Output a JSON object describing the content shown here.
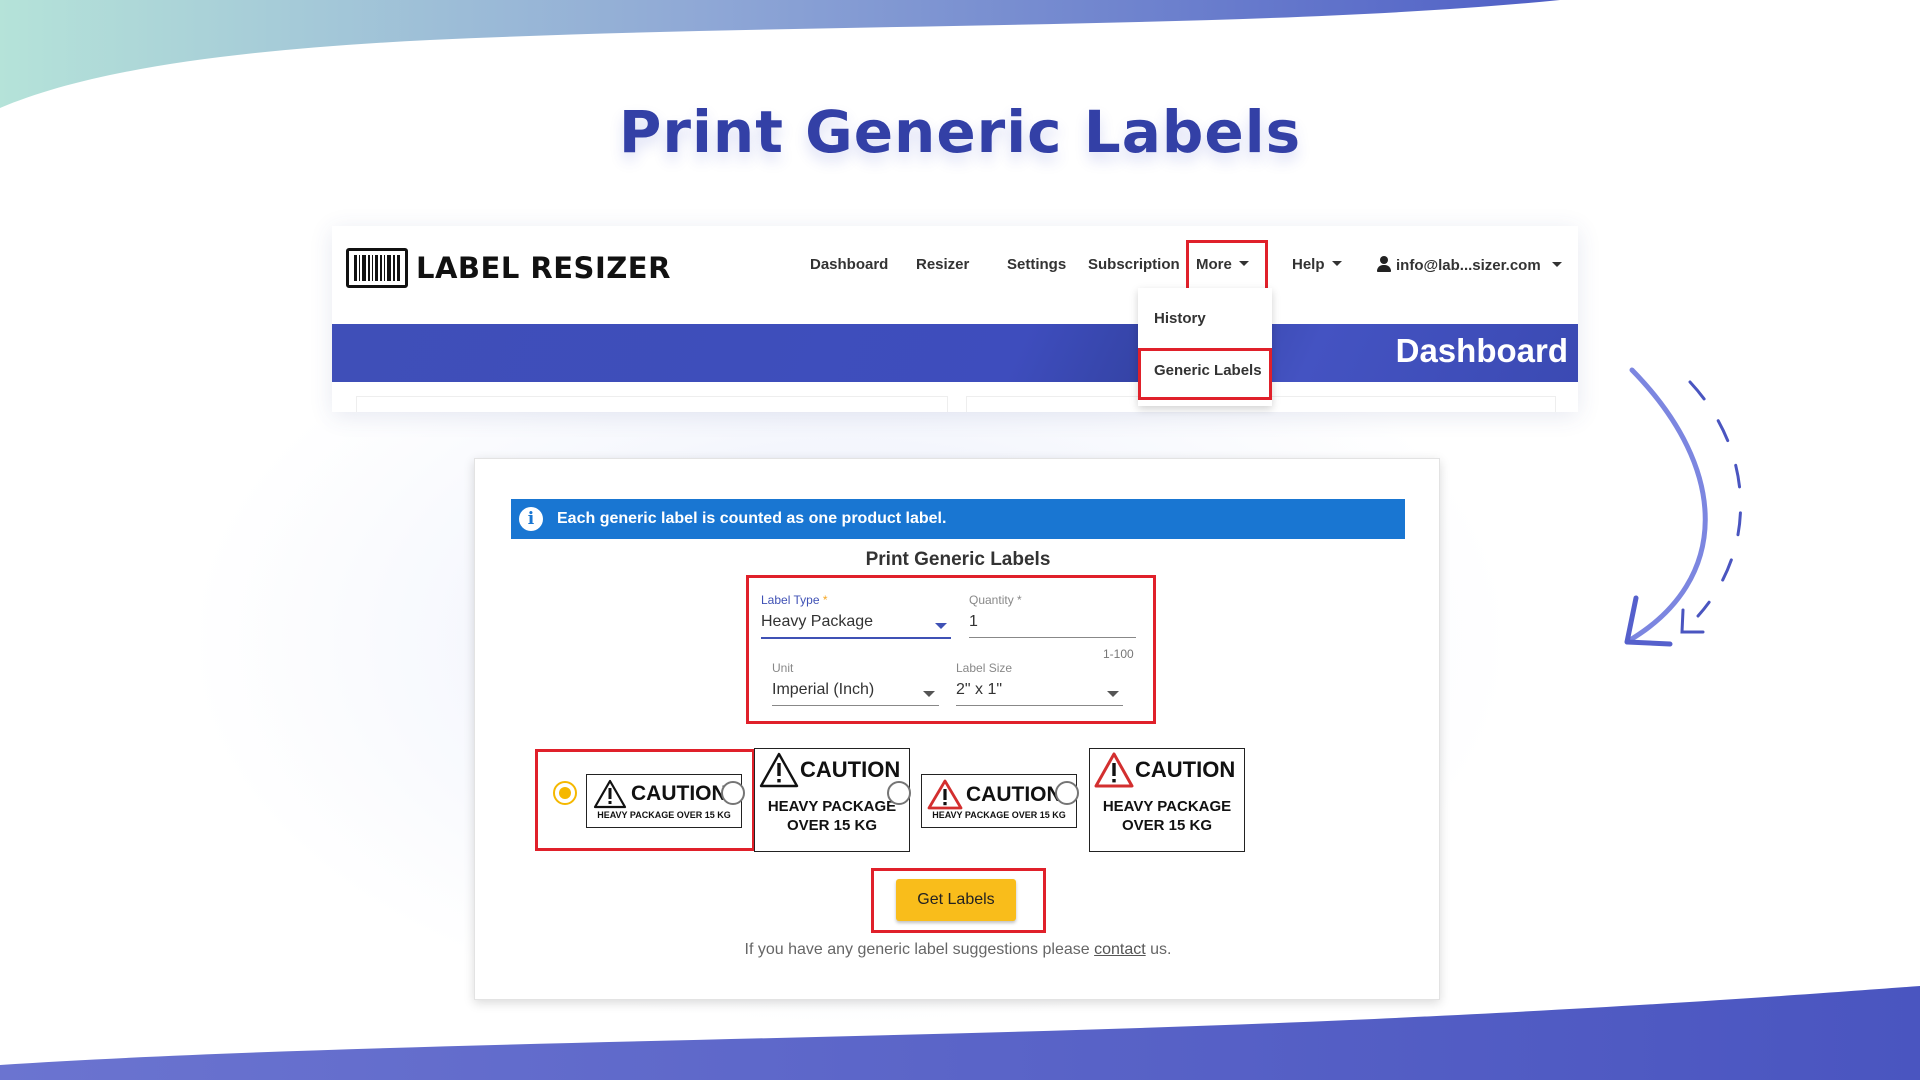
{
  "slide": {
    "heading": "Print Generic Labels"
  },
  "app": {
    "logo_text": "LABEL RESIZER",
    "nav": {
      "dashboard": "Dashboard",
      "resizer": "Resizer",
      "settings": "Settings",
      "subscription": "Subscription",
      "more": "More",
      "help": "Help",
      "account": "info@lab...sizer.com"
    },
    "more_menu": {
      "items": [
        "History",
        "Generic Labels"
      ]
    },
    "banner_title": "Dashboard"
  },
  "generic_labels": {
    "notice": "Each generic label is counted as one product label.",
    "title": "Print Generic Labels",
    "label_type": {
      "label": "Label Type",
      "required_mark": "*",
      "value": "Heavy Package"
    },
    "quantity": {
      "label": "Quantity",
      "required_mark": "*",
      "value": "1",
      "hint": "1-100"
    },
    "unit": {
      "label": "Unit",
      "value": "Imperial (Inch)"
    },
    "label_size": {
      "label": "Label Size",
      "value": "2\" x 1\""
    },
    "designs": [
      {
        "caption": "CAUTION",
        "text": "HEAVY PACKAGE OVER 15 KG",
        "selected": true
      },
      {
        "caption": "CAUTION",
        "text_line1": "HEAVY PACKAGE",
        "text_line2": "OVER 15 KG",
        "selected": false
      },
      {
        "caption": "CAUTION",
        "text": "HEAVY PACKAGE OVER 15 KG",
        "selected": false
      },
      {
        "caption": "CAUTION",
        "text_line1": "HEAVY PACKAGE",
        "text_line2": "OVER 15 KG",
        "selected": false
      }
    ],
    "get_labels_button": "Get Labels",
    "footer": {
      "prefix": "If you have any generic label suggestions please",
      "link": "contact",
      "suffix": "us."
    }
  },
  "colors": {
    "heading": "#3340a6",
    "banner": "#3f4fb8",
    "alert": "#1976d2",
    "highlight": "#e0202a",
    "button": "#f9bd1b",
    "radio_selected": "#f5b800",
    "warning_red": "#d32f2f"
  }
}
